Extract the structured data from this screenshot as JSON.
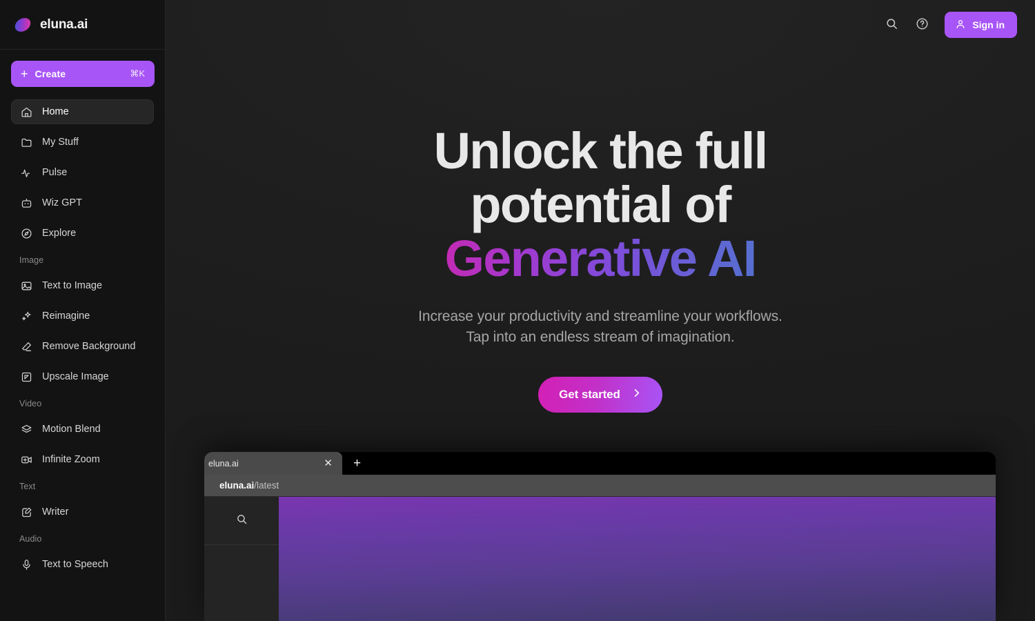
{
  "brand": {
    "name": "eluna.ai",
    "logo_icon": "eluna-ellipse-logo"
  },
  "sidebar": {
    "create": {
      "label": "Create",
      "shortcut": "⌘K",
      "icon": "plus-icon"
    },
    "primary_items": [
      {
        "label": "Home",
        "icon": "home-icon",
        "active": true
      },
      {
        "label": "My Stuff",
        "icon": "folder-icon",
        "active": false
      },
      {
        "label": "Pulse",
        "icon": "activity-pulse-icon",
        "active": false
      },
      {
        "label": "Wiz GPT",
        "icon": "robot-icon",
        "active": false
      },
      {
        "label": "Explore",
        "icon": "compass-icon",
        "active": false
      }
    ],
    "sections": [
      {
        "label": "Image",
        "items": [
          {
            "label": "Text to Image",
            "icon": "image-frame-icon"
          },
          {
            "label": "Reimagine",
            "icon": "sparkles-icon"
          },
          {
            "label": "Remove Background",
            "icon": "eraser-icon"
          },
          {
            "label": "Upscale Image",
            "icon": "upscale-arrow-icon"
          }
        ]
      },
      {
        "label": "Video",
        "items": [
          {
            "label": "Motion Blend",
            "icon": "layers-icon"
          },
          {
            "label": "Infinite Zoom",
            "icon": "video-plus-icon"
          }
        ]
      },
      {
        "label": "Text",
        "items": [
          {
            "label": "Writer",
            "icon": "pen-square-icon"
          }
        ]
      },
      {
        "label": "Audio",
        "items": [
          {
            "label": "Text to Speech",
            "icon": "microphone-icon"
          }
        ]
      }
    ]
  },
  "topbar": {
    "search_icon": "search-icon",
    "help_icon": "help-circle-icon",
    "signin_label": "Sign in",
    "signin_icon": "user-icon"
  },
  "hero": {
    "title_line1": "Unlock the full",
    "title_line2_plain": "potential of ",
    "title_line2_gradient": "Generative AI",
    "subtitle_line1": "Increase your productivity and streamline your workflows.",
    "subtitle_line2": "Tap into an endless stream of imagination.",
    "cta_label": "Get started",
    "cta_icon": "chevron-right-icon"
  },
  "mockup": {
    "tab_title": "eluna.ai",
    "tab_close_icon": "close-icon",
    "new_tab_icon": "plus-icon",
    "url_domain": "eluna.ai",
    "url_path": "/latest",
    "panel_search_icon": "search-icon"
  },
  "colors": {
    "accent_purple": "#a855f7",
    "gradient_pink": "#c32bb4",
    "gradient_blue": "#5570d0",
    "sidebar_bg": "#131313",
    "main_bg": "#1e1e1e"
  }
}
